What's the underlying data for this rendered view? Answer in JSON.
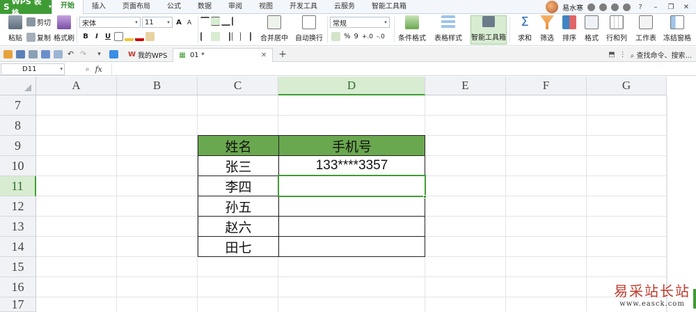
{
  "app": {
    "name": "WPS 表格",
    "logo": "S"
  },
  "menu_tabs": [
    "开始",
    "插入",
    "页面布局",
    "公式",
    "数据",
    "审阅",
    "视图",
    "开发工具",
    "云服务",
    "智能工具箱"
  ],
  "user": {
    "name": "易水寒"
  },
  "ribbon": {
    "paste": "粘贴",
    "cut": "剪切",
    "copy": "复制",
    "format_painter": "格式刷",
    "font_name": "宋体",
    "font_size": "11",
    "merge_center": "合并居中",
    "wrap_text": "自动换行",
    "number_format": "常规",
    "conditional_format": "条件格式",
    "table_style": "表格样式",
    "smart_toolbox": "智能工具箱",
    "sum": "求和",
    "filter": "筛选",
    "sort": "排序",
    "format": "格式",
    "row_col": "行和列",
    "worksheet": "工作表",
    "freeze": "冻结窗格",
    "bold": "B",
    "italic": "I",
    "underline": "U",
    "font_grow": "A",
    "font_shrink": "A",
    "percent": "%",
    "comma": "9",
    "dec_inc": "+.0",
    "dec_dec": "-.0"
  },
  "doc_tabs": [
    {
      "label": "我的WPS"
    },
    {
      "label": "01 *"
    }
  ],
  "search": {
    "label": "查找命令、搜索..."
  },
  "formula_bar": {
    "name_box": "D11",
    "fx": "fx",
    "zoom_icon": "⌕"
  },
  "columns": [
    "A",
    "B",
    "C",
    "D",
    "E",
    "F",
    "G"
  ],
  "rows": [
    "7",
    "8",
    "9",
    "10",
    "11",
    "12",
    "13",
    "14",
    "15",
    "16",
    "17"
  ],
  "table": {
    "header": [
      "姓名",
      "手机号"
    ],
    "rows": [
      [
        "张三",
        "133****3357"
      ],
      [
        "李四",
        ""
      ],
      [
        "孙五",
        ""
      ],
      [
        "赵六",
        ""
      ],
      [
        "田七",
        ""
      ]
    ]
  },
  "watermark": {
    "cn": "易采站长站",
    "en": "www.easck.com"
  },
  "colors": {
    "accent": "#3f9c35",
    "header_fill": "#6aa84f",
    "watermark": "#c0392b"
  }
}
